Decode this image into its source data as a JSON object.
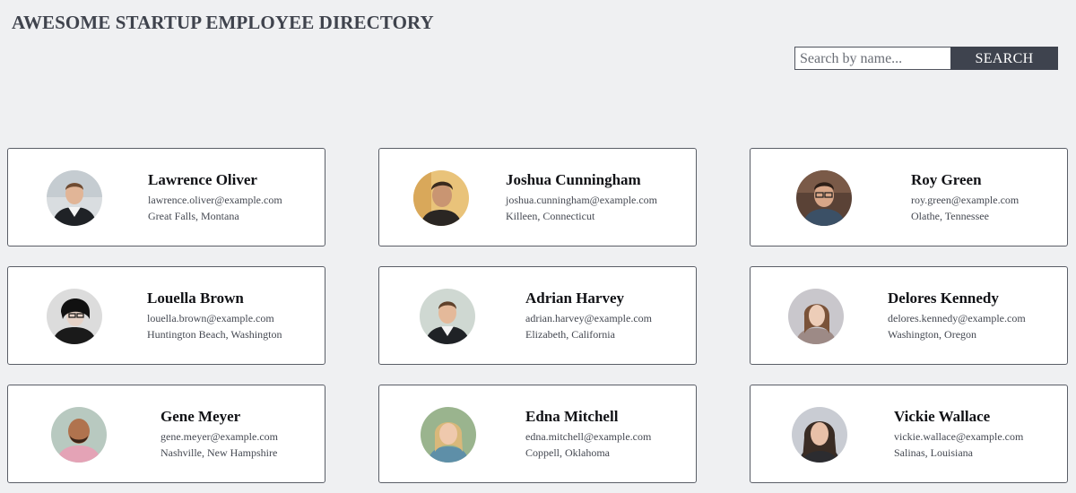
{
  "header": {
    "title": "AWESOME STARTUP EMPLOYEE DIRECTORY"
  },
  "search": {
    "placeholder": "Search by name...",
    "value": "",
    "button_label": "SEARCH"
  },
  "colors": {
    "background": "#eff0f2",
    "title": "#3f434d",
    "search_button": "#3e434e",
    "card_border": "#5a5e67"
  },
  "employees": [
    {
      "name": "Lawrence Oliver",
      "email": "lawrence.oliver@example.com",
      "location": "Great Falls, Montana"
    },
    {
      "name": "Joshua Cunningham",
      "email": "joshua.cunningham@example.com",
      "location": "Killeen, Connecticut"
    },
    {
      "name": "Roy Green",
      "email": "roy.green@example.com",
      "location": "Olathe, Tennessee"
    },
    {
      "name": "Louella Brown",
      "email": "louella.brown@example.com",
      "location": "Huntington Beach, Washington"
    },
    {
      "name": "Adrian Harvey",
      "email": "adrian.harvey@example.com",
      "location": "Elizabeth, California"
    },
    {
      "name": "Delores Kennedy",
      "email": "delores.kennedy@example.com",
      "location": "Washington, Oregon"
    },
    {
      "name": "Gene Meyer",
      "email": "gene.meyer@example.com",
      "location": "Nashville, New Hampshire"
    },
    {
      "name": "Edna Mitchell",
      "email": "edna.mitchell@example.com",
      "location": "Coppell, Oklahoma"
    },
    {
      "name": "Vickie Wallace",
      "email": "vickie.wallace@example.com",
      "location": "Salinas, Louisiana"
    }
  ]
}
